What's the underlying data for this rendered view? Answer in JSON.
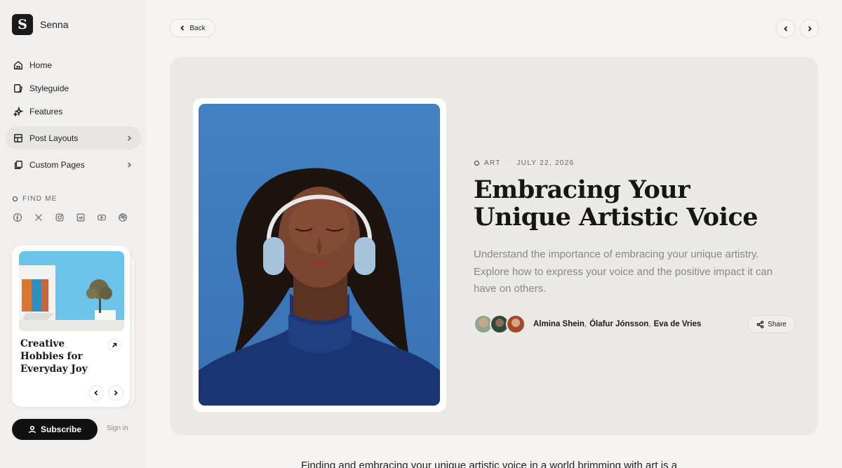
{
  "brand": {
    "logo_letter": "S",
    "name": "Senna"
  },
  "nav": {
    "items": [
      {
        "label": "Home",
        "icon": "home-icon"
      },
      {
        "label": "Styleguide",
        "icon": "styleguide-icon"
      },
      {
        "label": "Features",
        "icon": "sparkles-icon"
      },
      {
        "label": "Post Layouts",
        "icon": "layout-icon",
        "has_submenu": true,
        "active": true
      },
      {
        "label": "Custom Pages",
        "icon": "pages-icon",
        "has_submenu": true
      }
    ]
  },
  "find_me": {
    "label": "FIND ME",
    "socials": [
      "facebook-icon",
      "x-icon",
      "instagram-icon",
      "linkedin-icon",
      "youtube-icon",
      "dribbble-icon"
    ]
  },
  "promo": {
    "title": "Creative Hobbies for Everyday Joy"
  },
  "footer": {
    "subscribe_label": "Subscribe",
    "signin_label": "Sign in"
  },
  "toolbar": {
    "back_label": "Back"
  },
  "article": {
    "category": "ART",
    "date": "JULY 22, 2026",
    "title": "Embracing Your Unique Artistic Voice",
    "excerpt": "Understand the importance of embracing your unique artistry. Explore how to express your voice and the positive impact it can have on others.",
    "authors": [
      "Almina Shein",
      "Ólafur Jónsson",
      "Eva de Vries"
    ],
    "share_label": "Share",
    "body_preview": "Finding and embracing your unique artistic voice in a world brimming with art is a"
  },
  "colors": {
    "accent": "#111111",
    "hero_bg": "#ebe9e5",
    "sky": "#3c78bb"
  }
}
